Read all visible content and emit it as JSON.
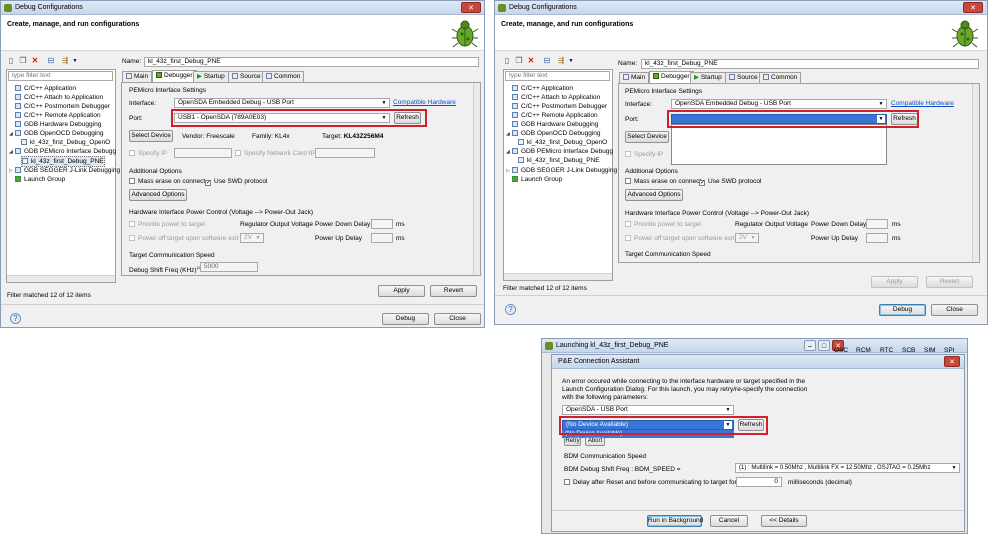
{
  "left": {
    "window_title": "Debug Configurations",
    "banner_title": "Create, manage, and run configurations",
    "filter_placeholder": "type filter text",
    "tree": [
      {
        "label": "C/C++ Application"
      },
      {
        "label": "C/C++ Attach to Application"
      },
      {
        "label": "C/C++ Postmortem Debugger"
      },
      {
        "label": "C/C++ Remote Application"
      },
      {
        "label": "GDB Hardware Debugging"
      },
      {
        "label": "GDB OpenOCD Debugging"
      },
      {
        "label": "kl_43z_first_Debug_OpenO"
      },
      {
        "label": "GDB PEMicro Interface Debugg"
      },
      {
        "label": "kl_43z_first_Debug_PNE"
      },
      {
        "label": "GDB SEGGER J-Link Debugging"
      },
      {
        "label": "Launch Group"
      }
    ],
    "filter_status": "Filter matched 12 of 12 items",
    "name_label": "Name:",
    "name_value": "kl_43z_first_Debug_PNE",
    "tabs": [
      "Main",
      "Debugger",
      "Startup",
      "Source",
      "Common"
    ],
    "settings_title": "PEMicro Interface Settings",
    "interface_label": "Interface:",
    "interface_value": "OpenSDA Embedded Debug - USB Port",
    "compatible_link": "Compatible Hardware",
    "port_label": "Port:",
    "port_value": "USB1 - OpenSDA (789A0E03)",
    "refresh": "Refresh",
    "select_device": "Select Device",
    "vendor": "Vendor: Freescale",
    "family": "Family: KL4x",
    "target_label": "Target:",
    "target_value": "KL43Z256M4",
    "specify_ip": "Specify IP",
    "specify_network": "Specify Network Card IP",
    "additional_options": "Additional Options",
    "mass_erase": "Mass erase on connect",
    "use_swd": "Use SWD protocol",
    "advanced_options": "Advanced Options",
    "hw_power_title": "Hardware Interface Power Control (Voltage --> Power-Out Jack)",
    "provide_power": "Provide power to target",
    "regulator_voltage": "Regulator Output Voltage",
    "power_down_delay": "Power Down Delay",
    "ms1": "ms",
    "power_off": "Power off target upon software exit",
    "voltage_value": "2V",
    "power_up_delay": "Power Up Delay",
    "ms2": "ms",
    "comm_speed_title": "Target Communication Speed",
    "debug_shift_label": "Debug Shift Freq (KHz)",
    "debug_shift_sup": "(1)",
    "debug_shift_value": "5000",
    "apply": "Apply",
    "revert": "Revert",
    "debug": "Debug",
    "close": "Close",
    "help": "?"
  },
  "right": {
    "window_title": "Debug Configurations",
    "banner_title": "Create, manage, and run configurations",
    "filter_placeholder": "type filter text",
    "tree": [
      {
        "label": "C/C++ Application"
      },
      {
        "label": "C/C++ Attach to Application"
      },
      {
        "label": "C/C++ Postmortem Debugger"
      },
      {
        "label": "C/C++ Remote Application"
      },
      {
        "label": "GDB Hardware Debugging"
      },
      {
        "label": "GDB OpenOCD Debugging"
      },
      {
        "label": "kl_43z_first_Debug_OpenO"
      },
      {
        "label": "GDB PEMicro Interface Debugg"
      },
      {
        "label": "kl_43z_first_Debug_PNE"
      },
      {
        "label": "GDB SEGGER J-Link Debugging"
      },
      {
        "label": "Launch Group"
      }
    ],
    "filter_status": "Filter matched 12 of 12 items",
    "name_label": "Name:",
    "name_value": "kl_43z_first_Debug_PNE",
    "tabs": [
      "Main",
      "Debugger",
      "Startup",
      "Source",
      "Common"
    ],
    "settings_title": "PEMicro Interface Settings",
    "interface_label": "Interface:",
    "interface_value": "OpenSDA Embedded Debug - USB Port",
    "compatible_link": "Compatible Hardware",
    "port_label": "Port:",
    "port_value": "",
    "refresh": "Refresh",
    "select_device": "Select Device",
    "specify_ip": "Specify IP",
    "additional_options": "Additional Options",
    "mass_erase": "Mass erase on connect",
    "use_swd": "Use SWD protocol",
    "advanced_options": "Advanced Options",
    "hw_power_title": "Hardware Interface Power Control (Voltage --> Power-Out Jack)",
    "provide_power": "Provide power to target",
    "regulator_voltage": "Regulator Output Voltage",
    "power_down_delay": "Power Down Delay",
    "ms1": "ms",
    "power_off": "Power off target upon software exit",
    "voltage_value": "2V",
    "power_up_delay": "Power Up Delay",
    "ms2": "ms",
    "comm_speed_title": "Target Communication Speed",
    "apply": "Apply",
    "revert": "Revert",
    "debug": "Debug",
    "close": "Close",
    "help": "?"
  },
  "bottom": {
    "back_title": "Launching kl_43z_first_Debug_PNE",
    "bg_tabs": [
      "OSC",
      "RCM",
      "RTC",
      "SCB",
      "SIM",
      "SPI"
    ],
    "dialog_title": "P&E Connection Assistant",
    "error_text_1": "An error occured while connecting to the interface hardware or target specified in the",
    "error_text_2": "Launch Configuration Dialog. For this launch, you may retry/re-specify the connection",
    "error_text_3": "with the following parameters:",
    "interface_value": "OpenSDA - USB Port",
    "port_value": "(No Device Available)",
    "dropdown_option": "(No Device Available)",
    "refresh": "Refresh",
    "retry": "Retry",
    "abort": "Abort",
    "bdm_title": "BDM Communication Speed",
    "bdm_label": "BDM Debug Shift Freq : BDM_SPEED =",
    "bdm_value": "(1) :  Multilink = 0.50Mhz  ,  Multilink FX = 12.50Mhz  ,  OSJTAG = 0.25Mhz",
    "delay_label": "Delay after Reset and before communicating to target for",
    "delay_value": "0",
    "delay_unit": "milliseconds (decimal)",
    "run_background": "Run in Background",
    "cancel": "Cancel",
    "details": "<< Details"
  },
  "colors": {
    "highlight_box": "#d0202a",
    "link": "#0b4fd1",
    "selection": "#3875d7"
  }
}
